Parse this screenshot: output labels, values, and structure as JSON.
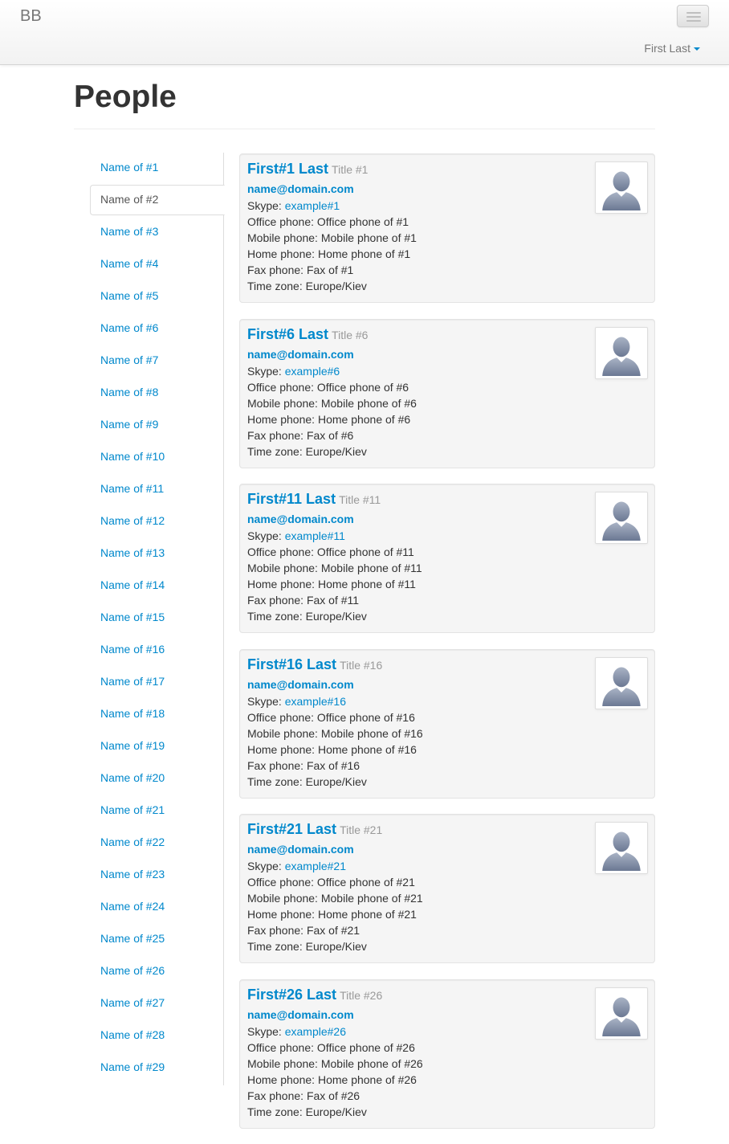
{
  "navbar": {
    "brand": "BB",
    "user": "First Last"
  },
  "page": {
    "title": "People"
  },
  "sidebar": {
    "active_index": 1,
    "items": [
      "Name of #1",
      "Name of #2",
      "Name of #3",
      "Name of #4",
      "Name of #5",
      "Name of #6",
      "Name of #7",
      "Name of #8",
      "Name of #9",
      "Name of #10",
      "Name of #11",
      "Name of #12",
      "Name of #13",
      "Name of #14",
      "Name of #15",
      "Name of #16",
      "Name of #17",
      "Name of #18",
      "Name of #19",
      "Name of #20",
      "Name of #21",
      "Name of #22",
      "Name of #23",
      "Name of #24",
      "Name of #25",
      "Name of #26",
      "Name of #27",
      "Name of #28",
      "Name of #29"
    ]
  },
  "labels": {
    "skype": "Skype: ",
    "office": "Office phone: ",
    "mobile": "Mobile phone: ",
    "home": "Home phone: ",
    "fax": "Fax phone: ",
    "timezone": "Time zone: "
  },
  "people": [
    {
      "name": "First#1 Last",
      "title": "Title #1",
      "email": "name@domain.com",
      "skype": "example#1",
      "office": "Office phone of #1",
      "mobile": "Mobile phone of #1",
      "home": "Home phone of #1",
      "fax": "Fax of #1",
      "timezone": "Europe/Kiev"
    },
    {
      "name": "First#6 Last",
      "title": "Title #6",
      "email": "name@domain.com",
      "skype": "example#6",
      "office": "Office phone of #6",
      "mobile": "Mobile phone of #6",
      "home": "Home phone of #6",
      "fax": "Fax of #6",
      "timezone": "Europe/Kiev"
    },
    {
      "name": "First#11 Last",
      "title": "Title #11",
      "email": "name@domain.com",
      "skype": "example#11",
      "office": "Office phone of #11",
      "mobile": "Mobile phone of #11",
      "home": "Home phone of #11",
      "fax": "Fax of #11",
      "timezone": "Europe/Kiev"
    },
    {
      "name": "First#16 Last",
      "title": "Title #16",
      "email": "name@domain.com",
      "skype": "example#16",
      "office": "Office phone of #16",
      "mobile": "Mobile phone of #16",
      "home": "Home phone of #16",
      "fax": "Fax of #16",
      "timezone": "Europe/Kiev"
    },
    {
      "name": "First#21 Last",
      "title": "Title #21",
      "email": "name@domain.com",
      "skype": "example#21",
      "office": "Office phone of #21",
      "mobile": "Mobile phone of #21",
      "home": "Home phone of #21",
      "fax": "Fax of #21",
      "timezone": "Europe/Kiev"
    },
    {
      "name": "First#26 Last",
      "title": "Title #26",
      "email": "name@domain.com",
      "skype": "example#26",
      "office": "Office phone of #26",
      "mobile": "Mobile phone of #26",
      "home": "Home phone of #26",
      "fax": "Fax of #26",
      "timezone": "Europe/Kiev"
    }
  ]
}
